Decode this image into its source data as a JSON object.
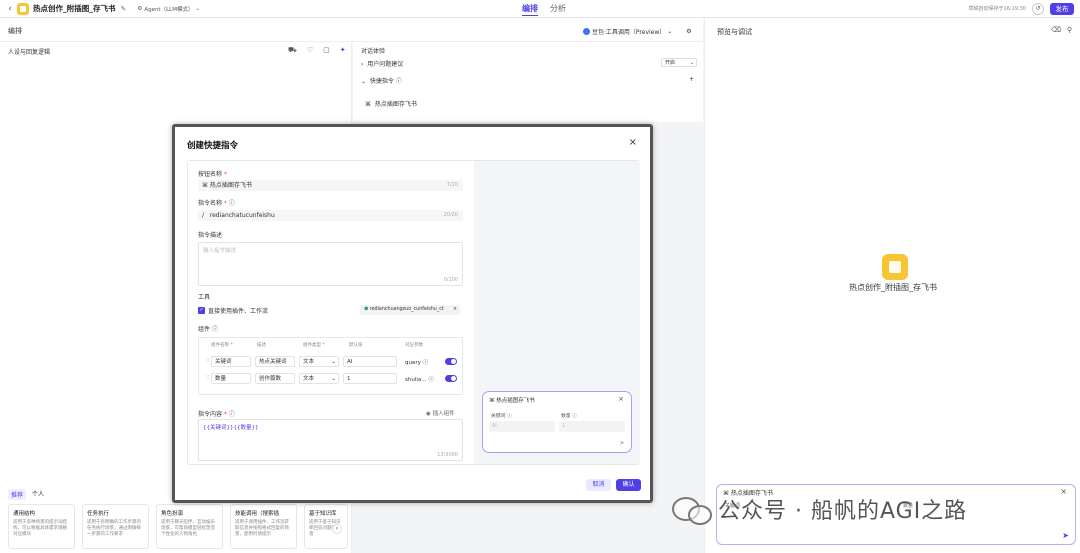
{
  "app": {
    "name": "热点创作_附插图_存飞书",
    "agent_mode": "Agent（LLM模式）"
  },
  "tabs": [
    {
      "label": "编排"
    },
    {
      "label": "分析"
    }
  ],
  "autosave": "草稿自动保存于16:19:30",
  "publish_label": "发布",
  "sections": {
    "orchestrate": "编排",
    "preview": "预览与调试"
  },
  "model": {
    "label": "豆包·工具调用（Preview）"
  },
  "left_pane": {
    "title": "人设与回复逻辑"
  },
  "mid_pane": {
    "title": "对话体验",
    "suggest_label": "用户问题建议",
    "suggest_value": "开启",
    "shortcut_label": "快捷指令",
    "shortcut_item": "热点插图存飞书",
    "add": "+"
  },
  "templates": {
    "tabs": [
      "推荐",
      "个人"
    ],
    "cards": [
      {
        "title": "通用结构",
        "desc": "适用于多种场景的提示词结构，可以根据具体需求增删对应模块"
      },
      {
        "title": "任务执行",
        "desc": "适用于有明确的工作步骤的任务执行场景，通过明确每一步骤的工作要求"
      },
      {
        "title": "角色扮演",
        "desc": "适用于聊天陪伴、互动娱乐场景，可帮助模型轻松塑造个性化的人物角色"
      },
      {
        "title": "技能调用（搜索插",
        "desc": "适用于调用插件、工作流获取信息并按照格式回复的场景，使用时请提示"
      },
      {
        "title": "基于知识库",
        "desc": "适用于基于知识库回答问题的场景"
      }
    ]
  },
  "preview": {
    "bot_name": "热点创作_附插图_存飞书",
    "chat_card_title": "热点插图存飞书",
    "chat_label_keyword": "关键词",
    "chat_label_count": "数量"
  },
  "watermark": "公众号 · 船帆的AGI之路",
  "modal": {
    "title": "创建快捷指令",
    "button_name_label": "按钮名称",
    "button_name_value": "热点插图存飞书",
    "button_name_count": "7/20",
    "cmd_name_label": "指令名称",
    "cmd_name_prefix": "/",
    "cmd_name_value": "redianchatucunfeishu",
    "cmd_name_count": "20/20",
    "cmd_desc_label": "指令描述",
    "cmd_desc_placeholder": "输入指令描述",
    "cmd_desc_count": "0/100",
    "tools_label": "工具",
    "tools_checkbox": "直接使用插件、工作流",
    "tool_chip": "redianchuangzuo_cunfeishu_ct",
    "components_label": "组件",
    "comp_headers": [
      "组件名称",
      "描述",
      "组件类型",
      "默认值",
      "对应参数"
    ],
    "components": [
      {
        "name": "关键词",
        "desc": "热点关键词",
        "type": "文本",
        "default": "AI",
        "param": "query"
      },
      {
        "name": "数量",
        "desc": "创作篇数",
        "type": "文本",
        "default": "1",
        "param": "shulia..."
      }
    ],
    "content_label": "指令内容",
    "insert_component": "插入组件",
    "content_value": "{{关键词}}{{数量}}",
    "content_count": "13/3000",
    "preview_card_title": "热点插图存飞书",
    "preview_keyword": "关键词",
    "preview_count": "数量",
    "preview_keyword_placeholder": "AI",
    "preview_count_placeholder": "1",
    "cancel": "取消",
    "confirm": "确认"
  }
}
